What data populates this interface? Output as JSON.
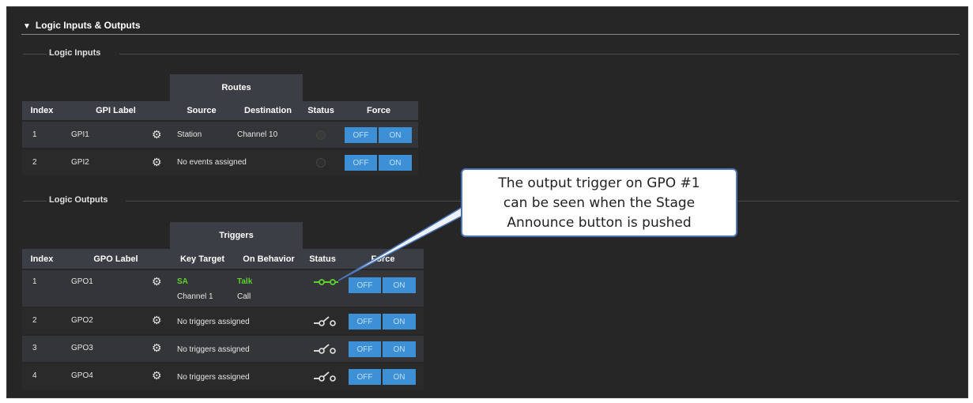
{
  "section": {
    "title": "Logic Inputs & Outputs"
  },
  "inputs": {
    "title": "Logic Inputs",
    "group_header": "Routes",
    "headers": {
      "index": "Index",
      "label": "GPI Label",
      "source": "Source",
      "destination": "Destination",
      "status": "Status",
      "force": "Force"
    },
    "rows": [
      {
        "index": "1",
        "label": "GPI1",
        "source": "Station",
        "destination": "Channel 10",
        "status": "inactive",
        "off": "OFF",
        "on": "ON"
      },
      {
        "index": "2",
        "label": "GPI2",
        "source": "No events assigned",
        "destination": "",
        "status": "inactive",
        "off": "OFF",
        "on": "ON"
      }
    ]
  },
  "outputs": {
    "title": "Logic Outputs",
    "group_header": "Triggers",
    "headers": {
      "index": "Index",
      "label": "GPO Label",
      "key_target": "Key Target",
      "on_behavior": "On Behavior",
      "status": "Status",
      "force": "Force"
    },
    "rows": [
      {
        "index": "1",
        "label": "GPO1",
        "key_target": "SA",
        "on_behavior": "Talk",
        "key_target2": "Channel 1",
        "on_behavior2": "Call",
        "status": "closed",
        "off": "OFF",
        "on": "ON"
      },
      {
        "index": "2",
        "label": "GPO2",
        "key_target": "No triggers assigned",
        "status": "open",
        "off": "OFF",
        "on": "ON"
      },
      {
        "index": "3",
        "label": "GPO3",
        "key_target": "No triggers assigned",
        "status": "open",
        "off": "OFF",
        "on": "ON"
      },
      {
        "index": "4",
        "label": "GPO4",
        "key_target": "No triggers assigned",
        "status": "open",
        "off": "OFF",
        "on": "ON"
      }
    ]
  },
  "callout": {
    "line1": "The output trigger on GPO #1",
    "line2": "can be seen when the Stage",
    "line3": "Announce button is pushed"
  },
  "colors": {
    "accent": "#3d8fd6",
    "active": "#5fd12f",
    "panel": "#262626",
    "header": "#3b3f45"
  },
  "icons": {
    "settings": "gear-icon",
    "expand": "chevron-down-icon",
    "switch_closed": "switch-closed-icon",
    "switch_open": "switch-open-icon"
  }
}
